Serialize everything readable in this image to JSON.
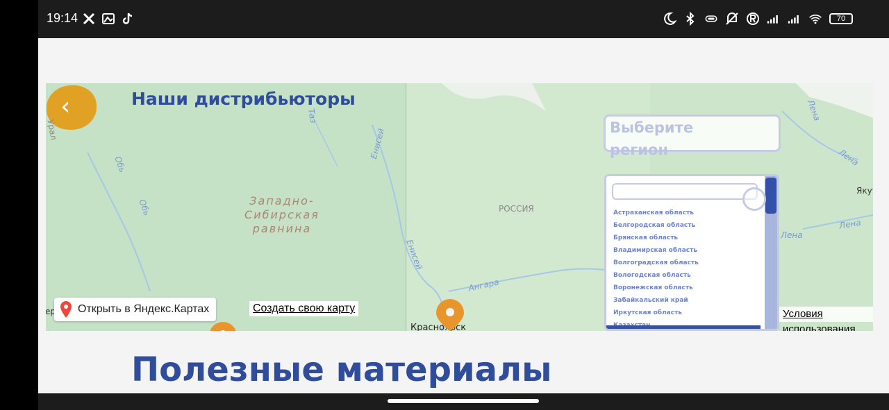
{
  "status_bar": {
    "time": "19:14",
    "left_icons": [
      "tools-icon",
      "photo-icon",
      "tiktok-icon"
    ],
    "right_icons": [
      "moon-icon",
      "bluetooth-icon",
      "vibrate-icon",
      "mute-icon",
      "registered-icon",
      "signal-icon",
      "signal-icon-2",
      "wifi-icon"
    ],
    "battery": "70"
  },
  "map": {
    "title": "Наши дистрибьюторы",
    "back_label": "‹",
    "region_select": {
      "placeholder": "Выберите регион"
    },
    "dropdown": {
      "search_value": "",
      "options": [
        "Астраханская область",
        "Белгородская область",
        "Брянская область",
        "Владимирская область",
        "Волгоградская область",
        "Вологодская область",
        "Воронежская область",
        "Забайкальский край",
        "Иркутская область",
        "Казахстан"
      ]
    },
    "labels": {
      "region": "Западно-\nСибирская\nравнина",
      "country": "РОССИЯ",
      "river_ob": "Обь",
      "river_ob2": "Обь",
      "river_enisey": "Енисей",
      "river_enisey2": "Енисей",
      "river_angara": "Ангара",
      "river_lena": "Лена",
      "river_lena2": "Лена",
      "river_lena3": "Лена",
      "river_lena4": "Лена",
      "river_taz": "Таз",
      "city_yakutsk": "Якутск",
      "city_krasnoyarsk": "Красноярск",
      "edge_left": "Урал",
      "edge_left2": "тер"
    },
    "open_yandex": "Открыть в Яндекс.Картах",
    "create_map": "Создать свою карту",
    "terms": "Условия использования"
  },
  "section": {
    "heading": "Полезные материалы"
  },
  "colors": {
    "accent": "#2f4d9a",
    "pin": "#e8962b",
    "back": "#e0a124"
  }
}
